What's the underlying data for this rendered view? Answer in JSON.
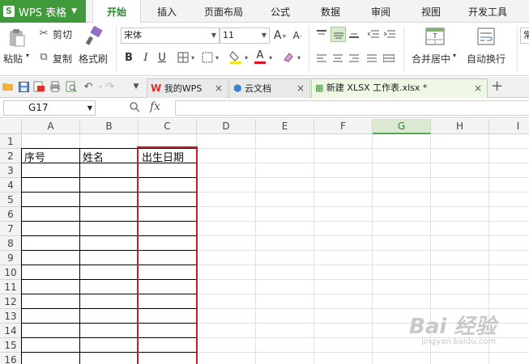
{
  "app": {
    "title": "WPS 表格",
    "logo": "S"
  },
  "menu_tabs": [
    "开始",
    "插入",
    "页面布局",
    "公式",
    "数据",
    "审阅",
    "视图",
    "开发工具"
  ],
  "active_menu_tab": "开始",
  "ribbon": {
    "paste": "粘贴",
    "cut": "剪切",
    "copy": "复制",
    "format_painter": "格式刷",
    "font_name": "宋体",
    "font_size": "11",
    "bold": "B",
    "italic": "I",
    "underline": "U",
    "font_color_glyph": "A",
    "merge_center": "合并居中",
    "wrap_text": "自动换行",
    "cut_right": "常"
  },
  "doc_tabs": [
    {
      "label": "我的WPS",
      "active": false
    },
    {
      "label": "云文档",
      "active": false
    },
    {
      "label": "新建 XLSX 工作表.xlsx *",
      "active": true
    }
  ],
  "add_tab": "+",
  "formula_bar": {
    "cell_ref": "G17",
    "fx": "fx",
    "value": ""
  },
  "columns": [
    "A",
    "B",
    "C",
    "D",
    "E",
    "F",
    "G",
    "H",
    "I"
  ],
  "selected_column": "G",
  "rows": [
    "1",
    "2",
    "3",
    "4",
    "5",
    "6",
    "7",
    "8",
    "9",
    "10",
    "11",
    "12",
    "13",
    "14",
    "15",
    "16"
  ],
  "cells": {
    "A2": "序号",
    "B2": "姓名",
    "C2": "出生日期"
  },
  "highlight_color": "#c0202a",
  "accent_color": "#3f9a3a",
  "watermark": {
    "brand": "Bai 经验",
    "url": "jingyan.baidu.com"
  }
}
